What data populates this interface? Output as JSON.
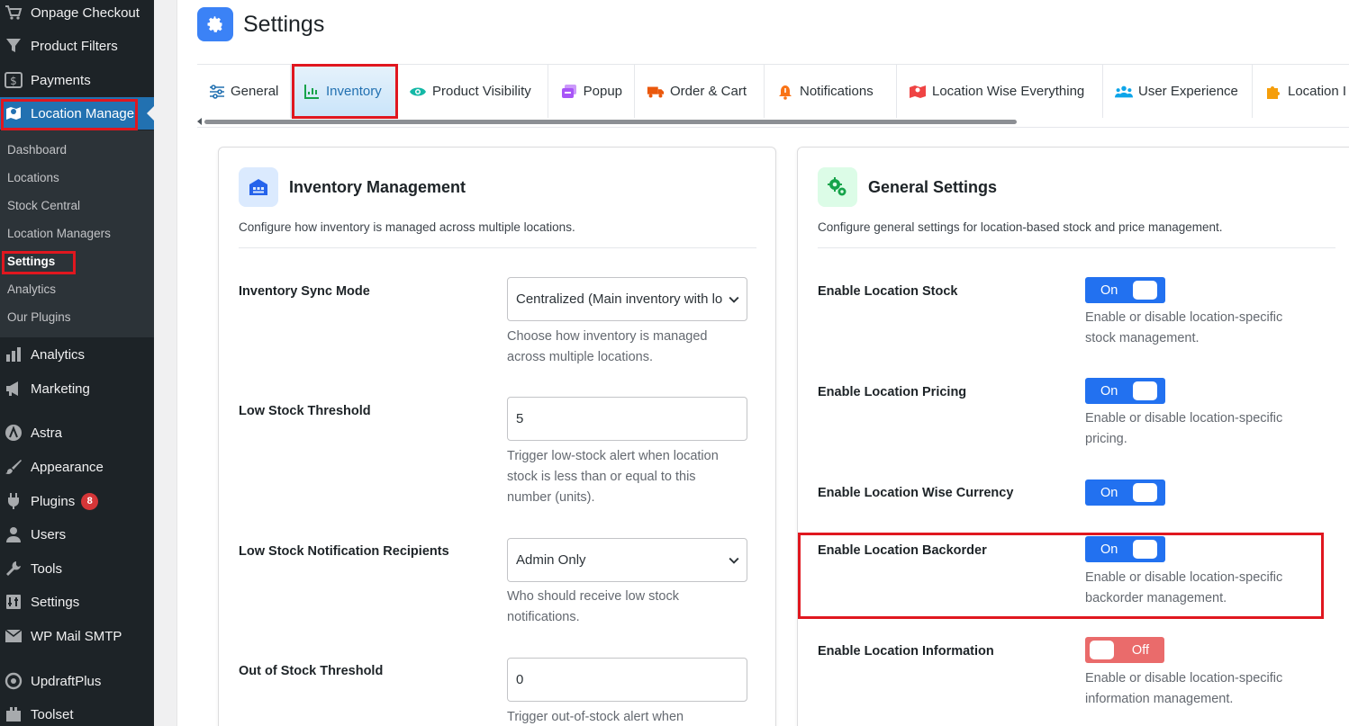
{
  "sidebar": {
    "menu": [
      {
        "label": "Onpage Checkout",
        "icon": "cart-icon"
      },
      {
        "label": "Product Filters",
        "icon": "filter-icon"
      },
      {
        "label": "Payments",
        "icon": "dollar-icon"
      },
      {
        "label": "Location Manage",
        "icon": "map-marker-icon"
      },
      {
        "label": "Analytics",
        "icon": "chart-bars-icon"
      },
      {
        "label": "Marketing",
        "icon": "megaphone-icon"
      },
      {
        "label": "Astra",
        "icon": "astra-icon"
      },
      {
        "label": "Appearance",
        "icon": "paintbrush-icon"
      },
      {
        "label": "Plugins",
        "icon": "plug-icon",
        "badge": "8"
      },
      {
        "label": "Users",
        "icon": "user-icon"
      },
      {
        "label": "Tools",
        "icon": "wrench-icon"
      },
      {
        "label": "Settings",
        "icon": "sliders-icon"
      },
      {
        "label": "WP Mail SMTP",
        "icon": "mail-icon"
      },
      {
        "label": "UpdraftPlus",
        "icon": "updraft-icon"
      },
      {
        "label": "Toolset",
        "icon": "toolset-icon"
      }
    ],
    "submenu": [
      "Dashboard",
      "Locations",
      "Stock Central",
      "Location Managers",
      "Settings",
      "Analytics",
      "Our Plugins"
    ]
  },
  "page": {
    "title": "Settings"
  },
  "tabs": [
    {
      "label": "General",
      "icon": "sliders-icon"
    },
    {
      "label": "Inventory",
      "icon": "chart-icon"
    },
    {
      "label": "Product Visibility",
      "icon": "eye-icon"
    },
    {
      "label": "Popup",
      "icon": "popup-icon"
    },
    {
      "label": "Order & Cart",
      "icon": "truck-icon"
    },
    {
      "label": "Notifications",
      "icon": "bell-icon"
    },
    {
      "label": "Location Wise Everything",
      "icon": "map-icon"
    },
    {
      "label": "User Experience",
      "icon": "users-icon"
    },
    {
      "label": "Location I",
      "icon": "puzzle-icon"
    }
  ],
  "inventory": {
    "title": "Inventory Management",
    "description": "Configure how inventory is managed across multiple locations.",
    "fields": [
      {
        "label": "Inventory Sync Mode",
        "value": "Centralized (Main inventory with lo",
        "helper": [
          "Choose how inventory is managed",
          "across multiple locations."
        ]
      },
      {
        "label": "Low Stock Threshold",
        "value": "5",
        "helper": [
          "Trigger low-stock alert when location",
          "stock is less than or equal to this",
          "number (units)."
        ]
      },
      {
        "label": "Low Stock Notification Recipients",
        "value": "Admin Only",
        "helper": [
          "Who should receive low stock",
          "notifications."
        ]
      },
      {
        "label": "Out of Stock Threshold",
        "value": "0",
        "helper": [
          "Trigger out-of-stock alert when"
        ]
      }
    ]
  },
  "general": {
    "title": "General Settings",
    "description": "Configure general settings for location-based stock and price management.",
    "settings": [
      {
        "label": "Enable Location Stock",
        "state": "On",
        "helper": [
          "Enable or disable location-specific",
          "stock management."
        ]
      },
      {
        "label": "Enable Location Pricing",
        "state": "On",
        "helper": [
          "Enable or disable location-specific",
          "pricing."
        ]
      },
      {
        "label": "Enable Location Wise Currency",
        "state": "On",
        "helper": []
      },
      {
        "label": "Enable Location Backorder",
        "state": "On",
        "helper": [
          "Enable or disable location-specific",
          "backorder management."
        ]
      },
      {
        "label": "Enable Location Information",
        "state": "Off",
        "helper": [
          "Enable or disable location-specific",
          "information management."
        ]
      }
    ]
  },
  "colors": {
    "accent": "#2271f0",
    "highlight": "#e0171f",
    "off": "#ea6b6b"
  }
}
